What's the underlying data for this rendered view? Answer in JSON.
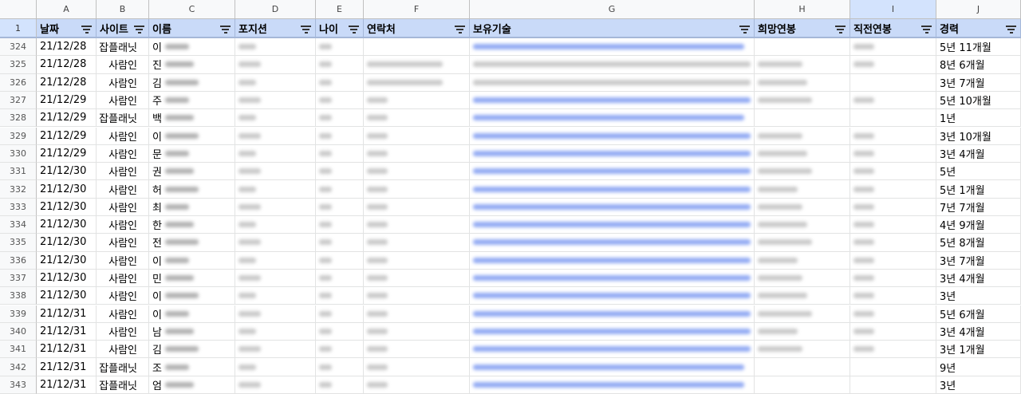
{
  "columns": [
    "",
    "A",
    "B",
    "C",
    "D",
    "E",
    "F",
    "G",
    "H",
    "I",
    "J"
  ],
  "selected_column": "I",
  "header": {
    "row_number": "1",
    "cells": [
      "날짜",
      "사이트",
      "이름",
      "포지션",
      "나이",
      "연락처",
      "보유기술",
      "희망연봉",
      "직전연봉",
      "경력"
    ]
  },
  "rows": [
    {
      "n": "324",
      "date": "21/12/28",
      "site": "잡플래닛",
      "name_first": "이",
      "contact": false,
      "link": true,
      "desired": false,
      "prev": true,
      "career": "5년 11개월"
    },
    {
      "n": "325",
      "date": "21/12/28",
      "site": "사람인",
      "name_first": "진",
      "contact": true,
      "link": false,
      "desired": true,
      "prev": true,
      "career": "8년 6개월"
    },
    {
      "n": "326",
      "date": "21/12/28",
      "site": "사람인",
      "name_first": "김",
      "contact": true,
      "link": false,
      "desired": true,
      "prev": false,
      "career": "3년 7개월"
    },
    {
      "n": "327",
      "date": "21/12/29",
      "site": "사람인",
      "name_first": "주",
      "contact": true,
      "link": true,
      "desired": true,
      "prev": true,
      "career": "5년 10개월"
    },
    {
      "n": "328",
      "date": "21/12/29",
      "site": "잡플래닛",
      "name_first": "백",
      "contact": true,
      "link": true,
      "desired": false,
      "prev": false,
      "career": "1년"
    },
    {
      "n": "329",
      "date": "21/12/29",
      "site": "사람인",
      "name_first": "이",
      "contact": true,
      "link": true,
      "desired": true,
      "prev": true,
      "career": "3년 10개월"
    },
    {
      "n": "330",
      "date": "21/12/29",
      "site": "사람인",
      "name_first": "문",
      "contact": true,
      "link": true,
      "desired": true,
      "prev": true,
      "career": "3년 4개월"
    },
    {
      "n": "331",
      "date": "21/12/30",
      "site": "사람인",
      "name_first": "권",
      "contact": true,
      "link": true,
      "desired": true,
      "prev": true,
      "career": "5년"
    },
    {
      "n": "332",
      "date": "21/12/30",
      "site": "사람인",
      "name_first": "허",
      "contact": true,
      "link": true,
      "desired": true,
      "prev": true,
      "career": "5년 1개월"
    },
    {
      "n": "333",
      "date": "21/12/30",
      "site": "사람인",
      "name_first": "최",
      "contact": true,
      "link": true,
      "desired": true,
      "prev": true,
      "career": "7년 7개월"
    },
    {
      "n": "334",
      "date": "21/12/30",
      "site": "사람인",
      "name_first": "한",
      "contact": true,
      "link": true,
      "desired": true,
      "prev": true,
      "career": "4년 9개월"
    },
    {
      "n": "335",
      "date": "21/12/30",
      "site": "사람인",
      "name_first": "전",
      "contact": true,
      "link": true,
      "desired": true,
      "prev": true,
      "career": "5년 8개월"
    },
    {
      "n": "336",
      "date": "21/12/30",
      "site": "사람인",
      "name_first": "이",
      "contact": true,
      "link": true,
      "desired": true,
      "prev": true,
      "career": "3년 7개월"
    },
    {
      "n": "337",
      "date": "21/12/30",
      "site": "사람인",
      "name_first": "민",
      "contact": true,
      "link": true,
      "desired": true,
      "prev": true,
      "career": "3년 4개월"
    },
    {
      "n": "338",
      "date": "21/12/30",
      "site": "사람인",
      "name_first": "이",
      "contact": true,
      "link": true,
      "desired": true,
      "prev": true,
      "career": "3년"
    },
    {
      "n": "339",
      "date": "21/12/31",
      "site": "사람인",
      "name_first": "이",
      "contact": true,
      "link": true,
      "desired": true,
      "prev": true,
      "career": "5년  6개월"
    },
    {
      "n": "340",
      "date": "21/12/31",
      "site": "사람인",
      "name_first": "남",
      "contact": true,
      "link": true,
      "desired": true,
      "prev": true,
      "career": "3년 4개월"
    },
    {
      "n": "341",
      "date": "21/12/31",
      "site": "사람인",
      "name_first": "김",
      "contact": true,
      "link": true,
      "desired": true,
      "prev": true,
      "career": "3년 1개월"
    },
    {
      "n": "342",
      "date": "21/12/31",
      "site": "잡플래닛",
      "name_first": "조",
      "contact": true,
      "link": true,
      "desired": false,
      "prev": false,
      "career": "9년"
    },
    {
      "n": "343",
      "date": "21/12/31",
      "site": "잡플래닛",
      "name_first": "엄",
      "contact": true,
      "link": true,
      "desired": false,
      "prev": false,
      "career": "3년"
    }
  ],
  "colors": {
    "header_bg": "#c9daf8",
    "link": "#1155cc",
    "selected_col": "#d3e3fd"
  }
}
